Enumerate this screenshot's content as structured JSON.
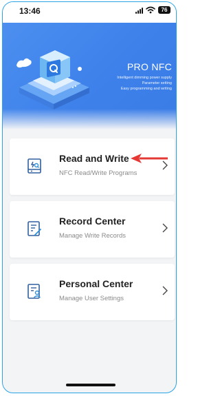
{
  "status_bar": {
    "time": "13:46",
    "battery": "76"
  },
  "hero": {
    "title": "PRO NFC",
    "lines": [
      "Intelligent dimming power supply",
      "Parameter setting",
      "Easy programming and writing"
    ],
    "colors": {
      "background": "#4285f4",
      "device": "#8fd0ff"
    }
  },
  "menu": [
    {
      "title": "Read and Write",
      "subtitle": "NFC Read/Write Programs",
      "icon": "nfc-phone-icon"
    },
    {
      "title": "Record Center",
      "subtitle": "Manage Write Records",
      "icon": "record-document-icon"
    },
    {
      "title": "Personal Center",
      "subtitle": "Manage User Settings",
      "icon": "user-document-icon"
    }
  ],
  "annotation": {
    "color": "#e53935",
    "target": "Read and Write"
  }
}
